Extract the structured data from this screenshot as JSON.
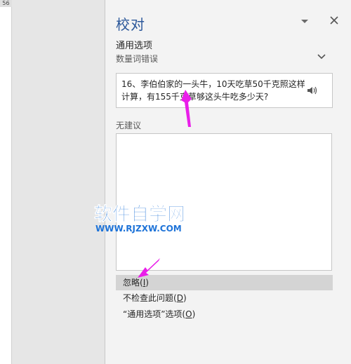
{
  "doc": {
    "page_number": "56"
  },
  "pane": {
    "title": "校对",
    "section_title": "通用选项",
    "section_sub": "数量词错误",
    "context_text": "16、李伯伯家的一头牛，10天吃草50千克照这样计算，有155千克草够这头牛吃多少天?",
    "no_suggestion_label": "无建议",
    "actions": {
      "ignore_text": "忽略(",
      "ignore_key": "I",
      "ignore_end": ")",
      "nocheck_text": "不检查此问题(",
      "nocheck_key": "D",
      "nocheck_end": ")",
      "options_text": "“通用选项”选项(",
      "options_key": "O",
      "options_end": ")"
    }
  },
  "watermark": {
    "line1": "软件自学网",
    "line2": "WWW.RJZXW.COM"
  },
  "colors": {
    "title_blue": "#2b579a",
    "arrow_magenta": "#e91ee9",
    "watermark_blue": "#1e73d8"
  },
  "icons": [
    "chevron-down-icon",
    "close-icon",
    "expand-chevron-icon",
    "speaker-icon"
  ]
}
